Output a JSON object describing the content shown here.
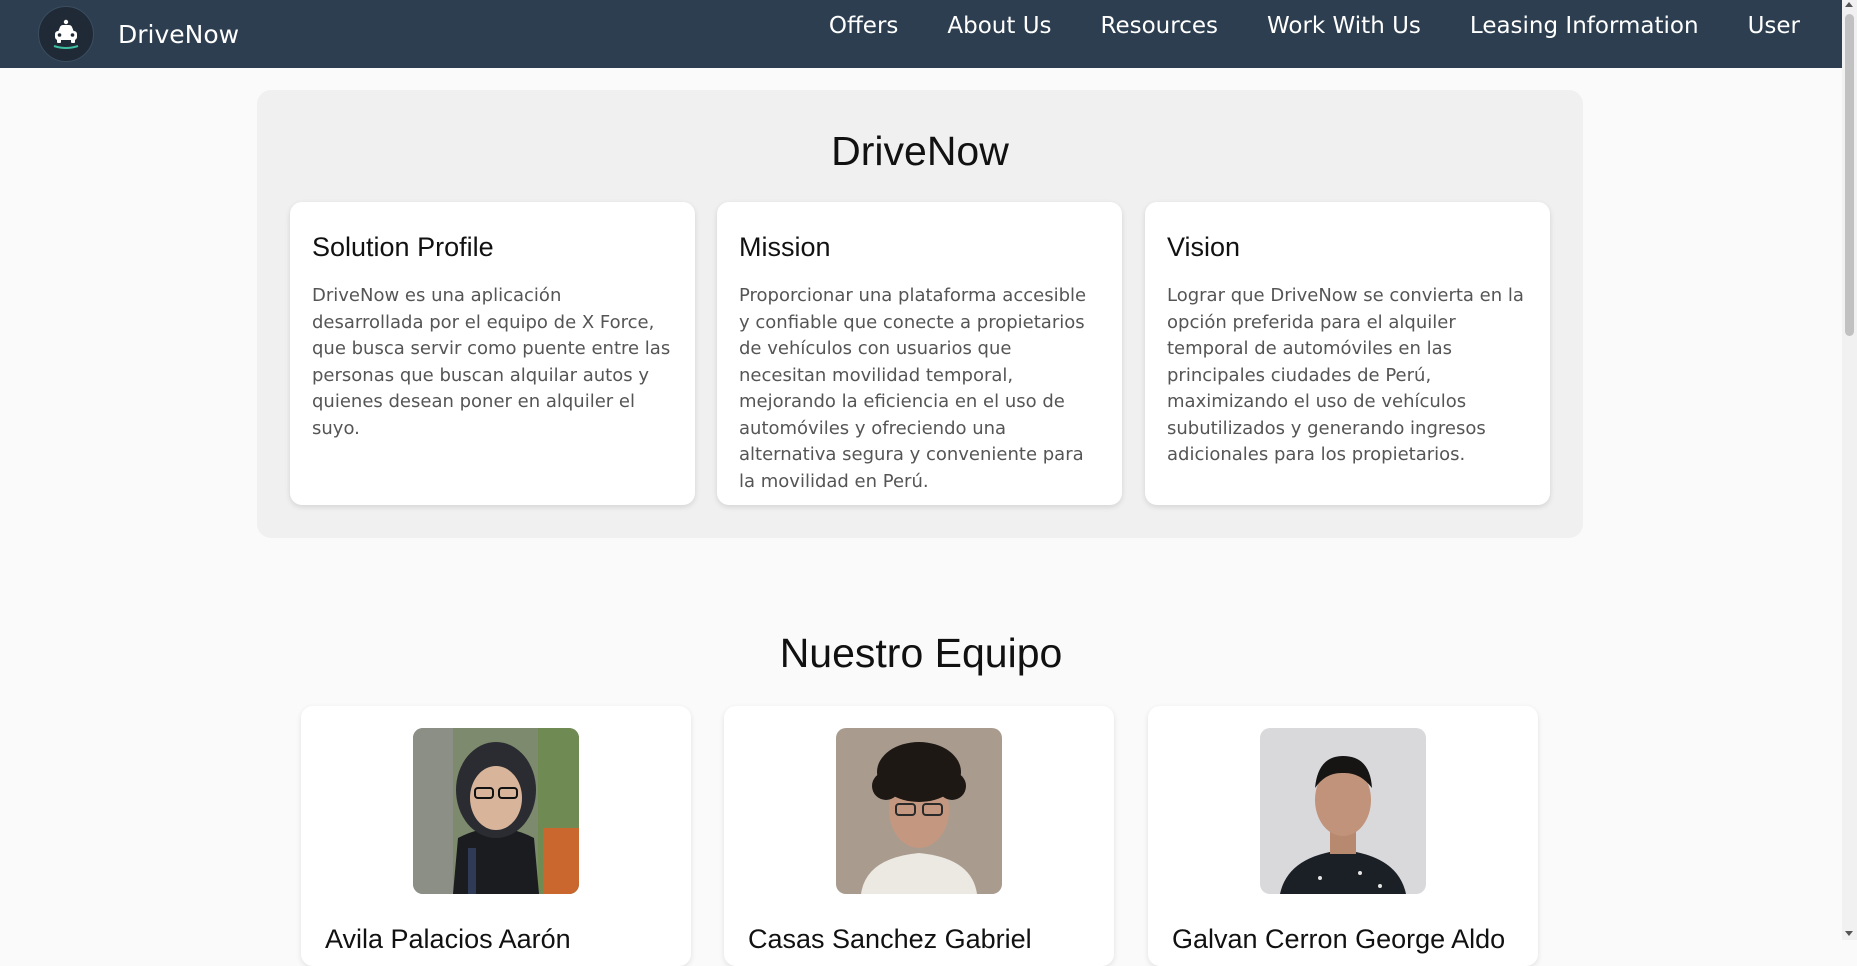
{
  "brand": {
    "name": "DriveNow",
    "logo_icon": "car-icon"
  },
  "nav": {
    "items": [
      {
        "label": "Offers"
      },
      {
        "label": "About Us"
      },
      {
        "label": "Resources"
      },
      {
        "label": "Work With Us"
      },
      {
        "label": "Leasing Information"
      },
      {
        "label": "User"
      }
    ]
  },
  "about": {
    "title": "DriveNow",
    "cards": [
      {
        "title": "Solution Profile",
        "text": "DriveNow es una aplicación desarrollada por el equipo de X Force, que busca servir como puente entre las personas que buscan alquilar autos y quienes desean poner en alquiler el suyo."
      },
      {
        "title": "Mission",
        "text": "Proporcionar una plataforma accesible y confiable que conecte a propietarios de vehículos con usuarios que necesitan movilidad temporal, mejorando la eficiencia en el uso de automóviles y ofreciendo una alternativa segura y conveniente para la movilidad en Perú."
      },
      {
        "title": "Vision",
        "text": "Lograr que DriveNow se convierta en la opción preferida para el alquiler temporal de automóviles en las principales ciudades de Perú, maximizando el uso de vehículos subutilizados y generando ingresos adicionales para los propietarios."
      }
    ]
  },
  "team": {
    "title": "Nuestro Equipo",
    "members": [
      {
        "name": "Avila Palacios Aarón"
      },
      {
        "name": "Casas Sanchez Gabriel"
      },
      {
        "name": "Galvan Cerron George Aldo"
      }
    ]
  },
  "colors": {
    "navbar": "#2c3e50",
    "page_background": "#fafafa",
    "section_background": "#f0f0f0",
    "body_text": "#555555"
  }
}
